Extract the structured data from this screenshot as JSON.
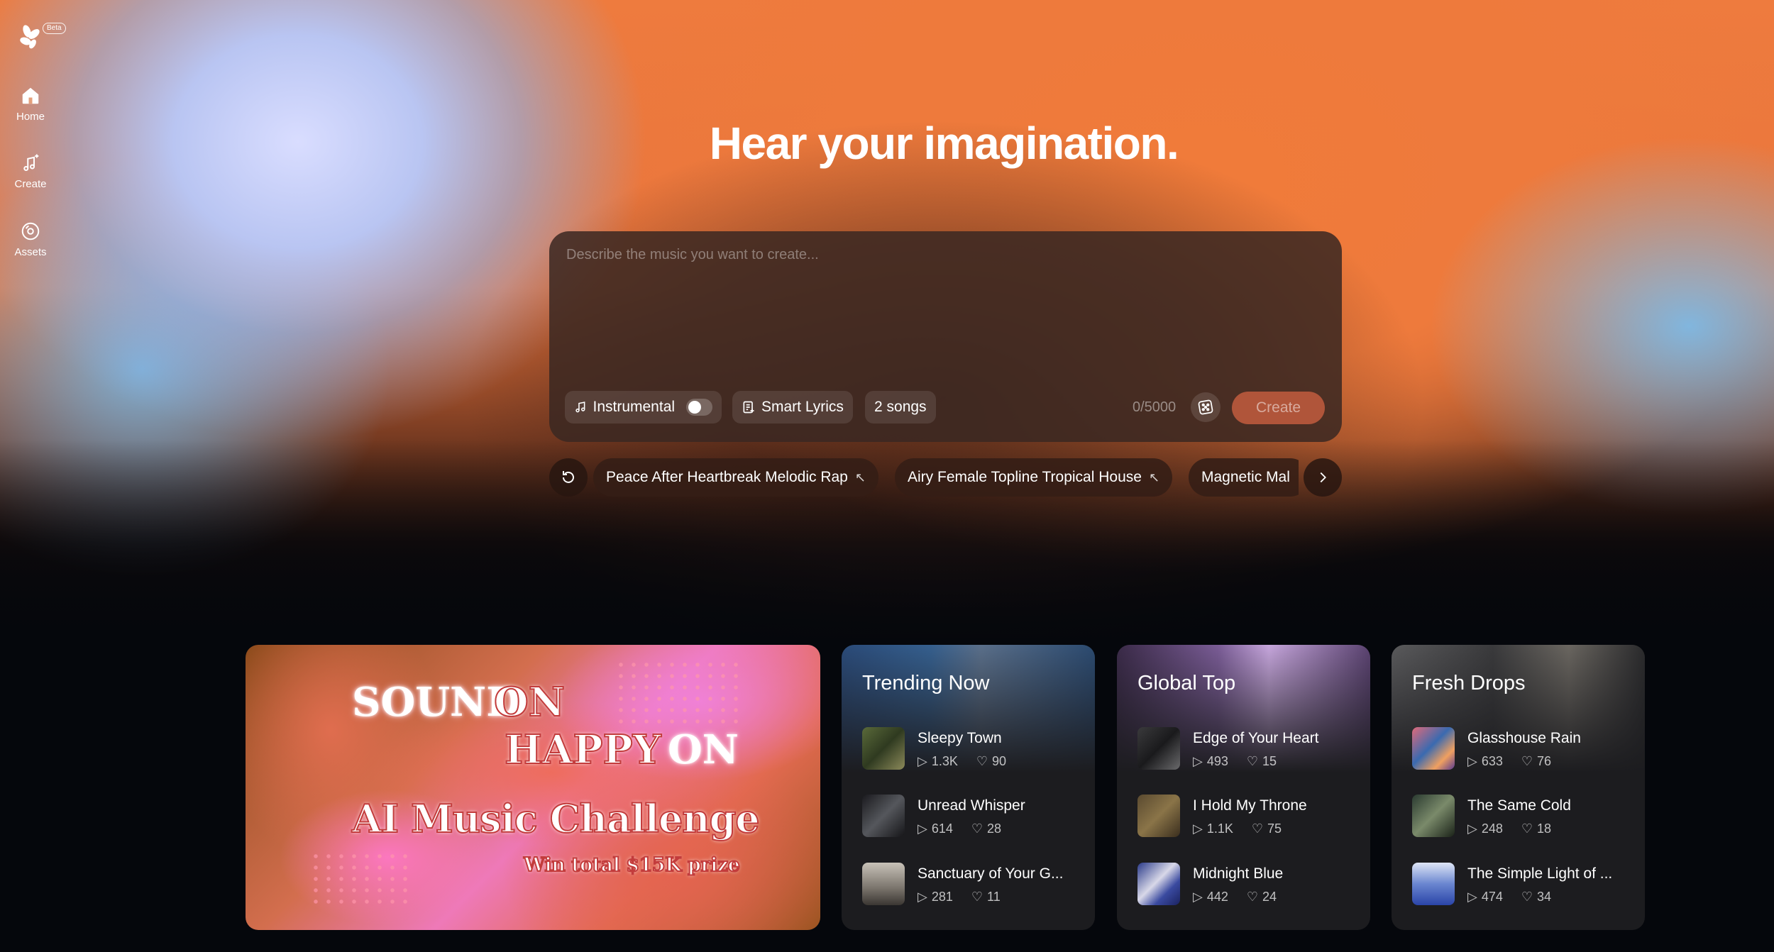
{
  "sidebar": {
    "beta_label": "Beta",
    "items": [
      {
        "label": "Home",
        "icon": "home-icon"
      },
      {
        "label": "Create",
        "icon": "music-note-sparkle-icon"
      },
      {
        "label": "Assets",
        "icon": "disc-icon"
      }
    ]
  },
  "hero": {
    "headline": "Hear your imagination."
  },
  "prompt": {
    "placeholder": "Describe the music you want to create...",
    "value": "",
    "instrumental_label": "Instrumental",
    "instrumental_on": false,
    "smart_lyrics_label": "Smart Lyrics",
    "songs_label": "2 songs",
    "counter": "0/5000",
    "create_label": "Create"
  },
  "suggestions": [
    {
      "label": "Peace After Heartbreak Melodic Rap"
    },
    {
      "label": "Airy Female Topline Tropical House"
    },
    {
      "label": "Magnetic Mal"
    }
  ],
  "banner": {
    "line1a": "SOUND",
    "line1b": "ON",
    "line2a": "HAPPY",
    "line2b": "ON",
    "line3": "AI Music Challenge",
    "line4": "Win total $15K prize"
  },
  "cards": [
    {
      "title": "Trending Now",
      "songs": [
        {
          "title": "Sleepy Town",
          "plays": "1.3K",
          "likes": "90"
        },
        {
          "title": "Unread Whisper",
          "plays": "614",
          "likes": "28"
        },
        {
          "title": "Sanctuary of Your G...",
          "plays": "281",
          "likes": "11"
        }
      ]
    },
    {
      "title": "Global Top",
      "songs": [
        {
          "title": "Edge of Your Heart",
          "plays": "493",
          "likes": "15"
        },
        {
          "title": "I Hold My Throne",
          "plays": "1.1K",
          "likes": "75"
        },
        {
          "title": "Midnight Blue",
          "plays": "442",
          "likes": "24"
        }
      ]
    },
    {
      "title": "Fresh Drops",
      "songs": [
        {
          "title": "Glasshouse Rain",
          "plays": "633",
          "likes": "76"
        },
        {
          "title": "The Same Cold",
          "plays": "248",
          "likes": "18"
        },
        {
          "title": "The Simple Light of ...",
          "plays": "474",
          "likes": "34"
        }
      ]
    }
  ],
  "colors": {
    "accent_orange": "#ee7b3e",
    "accent_blue": "#9cc4f0",
    "create_button": "#b0553a",
    "card_bg": "#1c1c1f",
    "page_bg": "#05070c"
  }
}
